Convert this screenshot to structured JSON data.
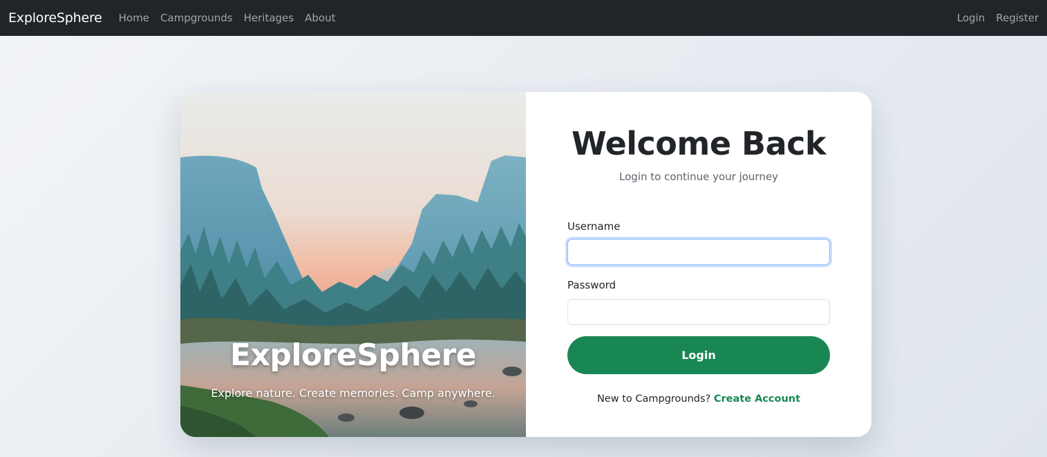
{
  "navbar": {
    "brand": "ExploreSphere",
    "links": [
      "Home",
      "Campgrounds",
      "Heritages",
      "About"
    ],
    "right_links": [
      "Login",
      "Register"
    ]
  },
  "hero": {
    "title": "ExploreSphere",
    "tagline": "Explore nature. Create memories. Camp anywhere."
  },
  "login_form": {
    "title": "Welcome Back",
    "subtitle": "Login to continue your journey",
    "username_label": "Username",
    "username_value": "",
    "password_label": "Password",
    "password_value": "",
    "submit_label": "Login",
    "signup_prompt": "New to Campgrounds?",
    "signup_link": "Create Account"
  },
  "colors": {
    "navbar_bg": "#212529",
    "accent_green": "#198754",
    "focus_blue": "#86b7fe"
  }
}
